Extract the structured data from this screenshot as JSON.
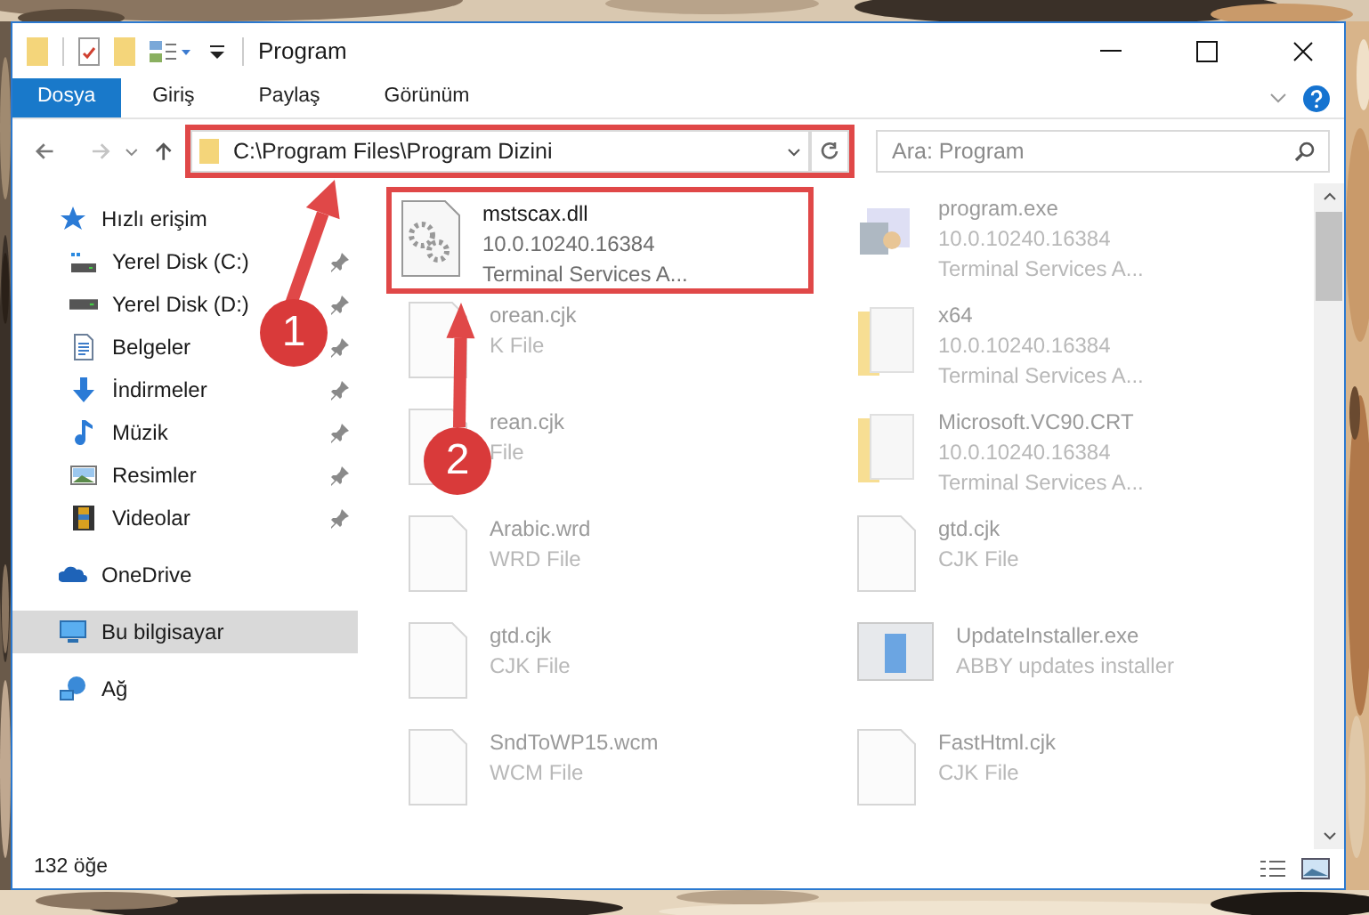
{
  "window": {
    "title": "Program"
  },
  "ribbon_tabs": [
    {
      "label": "Dosya",
      "selected": true
    },
    {
      "label": "Giriş",
      "selected": false
    },
    {
      "label": "Paylaş",
      "selected": false
    },
    {
      "label": "Görünüm",
      "selected": false
    }
  ],
  "address": {
    "value": "C:\\Program Files\\Program Dizini",
    "highlighted": true
  },
  "search": {
    "placeholder": "Ara: Program"
  },
  "sidebar": {
    "items": [
      {
        "label": "Hızlı erişim",
        "kind": "quick",
        "selected": false,
        "children": [
          {
            "label": "Yerel Disk (C:)",
            "kind": "drivec",
            "selected": false
          },
          {
            "label": "Yerel Disk (D:)",
            "kind": "drive",
            "selected": false
          },
          {
            "label": "Belgeler",
            "kind": "docs",
            "selected": false
          },
          {
            "label": "İndirmeler",
            "kind": "download",
            "selected": false
          },
          {
            "label": "Müzik",
            "kind": "music",
            "selected": false
          },
          {
            "label": "Resimler",
            "kind": "pictures",
            "selected": false
          },
          {
            "label": "Videolar",
            "kind": "videos",
            "selected": false
          }
        ]
      },
      {
        "label": "OneDrive",
        "kind": "cloud",
        "selected": false
      },
      {
        "label": "Bu bilgisayar",
        "kind": "pc",
        "selected": true
      },
      {
        "label": "Ağ",
        "kind": "network",
        "selected": false
      }
    ]
  },
  "files": [
    {
      "name": "mstscax.dll",
      "lines": [
        "10.0.10240.16384",
        "Terminal Services A..."
      ],
      "kind": "dll",
      "faded": false,
      "highlighted": true
    },
    {
      "name": "program.exe",
      "lines": [
        "10.0.10240.16384",
        "Terminal Services A..."
      ],
      "kind": "exe",
      "faded": true,
      "highlighted": false
    },
    {
      "name": "orean.cjk",
      "lines": [
        "K File"
      ],
      "kind": "blank",
      "faded": true,
      "highlighted": false
    },
    {
      "name": "x64",
      "lines": [
        "10.0.10240.16384",
        "Terminal Services A..."
      ],
      "kind": "folder",
      "faded": true,
      "highlighted": false
    },
    {
      "name": "rean.cjk",
      "lines": [
        "File"
      ],
      "kind": "blank",
      "faded": true,
      "highlighted": false
    },
    {
      "name": "Microsoft.VC90.CRT",
      "lines": [
        "10.0.10240.16384",
        "Terminal Services A..."
      ],
      "kind": "folder",
      "faded": true,
      "highlighted": false
    },
    {
      "name": "Arabic.wrd",
      "lines": [
        "WRD File"
      ],
      "kind": "blank",
      "faded": true,
      "highlighted": false
    },
    {
      "name": "gtd.cjk",
      "lines": [
        "CJK File"
      ],
      "kind": "blank",
      "faded": true,
      "highlighted": false
    },
    {
      "name": "gtd.cjk",
      "lines": [
        "CJK File"
      ],
      "kind": "blank",
      "faded": true,
      "highlighted": false
    },
    {
      "name": "UpdateInstaller.exe",
      "lines": [
        "ABBY updates installer"
      ],
      "kind": "installer",
      "faded": true,
      "highlighted": false
    },
    {
      "name": "SndToWP15.wcm",
      "lines": [
        "WCM File"
      ],
      "kind": "blank",
      "faded": true,
      "highlighted": false
    },
    {
      "name": "FastHtml.cjk",
      "lines": [
        "CJK File"
      ],
      "kind": "blank",
      "faded": true,
      "highlighted": false
    }
  ],
  "status_bar": {
    "count": "132 öğe"
  },
  "annotations": [
    {
      "label": "1"
    },
    {
      "label": "2"
    }
  ]
}
